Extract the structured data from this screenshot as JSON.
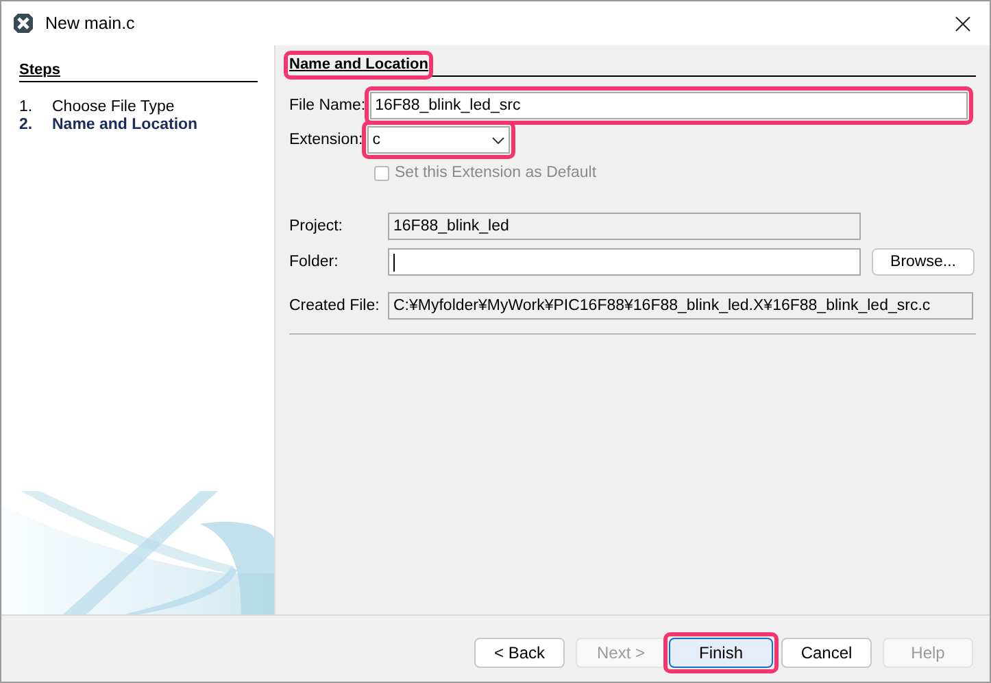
{
  "window": {
    "title": "New main.c"
  },
  "steps": {
    "heading": "Steps",
    "items": [
      {
        "number": "1.",
        "label": "Choose File Type",
        "selected": false
      },
      {
        "number": "2.",
        "label": "Name and Location",
        "selected": true
      }
    ]
  },
  "panel": {
    "heading": "Name and Location",
    "highlighted": true,
    "file_name": {
      "label": "File Name:",
      "value": "16F88_blink_led_src",
      "highlighted": true
    },
    "extension": {
      "label": "Extension:",
      "value": "c",
      "highlighted": true
    },
    "default_checkbox": {
      "label": "Set this Extension as Default",
      "checked": false,
      "disabled": true
    },
    "project": {
      "label": "Project:",
      "value": "16F88_blink_led"
    },
    "folder": {
      "label": "Folder:",
      "button": "Browse..."
    },
    "created_file": {
      "label": "Created File:",
      "value": "C:¥Myfolder¥MyWork¥PIC16F88¥16F88_blink_led.X¥16F88_blink_led_src.c"
    }
  },
  "buttons": [
    {
      "label": "< Back",
      "disabled": false,
      "default": false,
      "highlighted": false
    },
    {
      "label": "Next >",
      "disabled": true,
      "default": false,
      "highlighted": false
    },
    {
      "label": "Finish",
      "disabled": false,
      "default": true,
      "highlighted": true
    },
    {
      "label": "Cancel",
      "disabled": false,
      "default": false,
      "highlighted": false
    },
    {
      "label": "Help",
      "disabled": true,
      "default": false,
      "highlighted": false
    }
  ]
}
